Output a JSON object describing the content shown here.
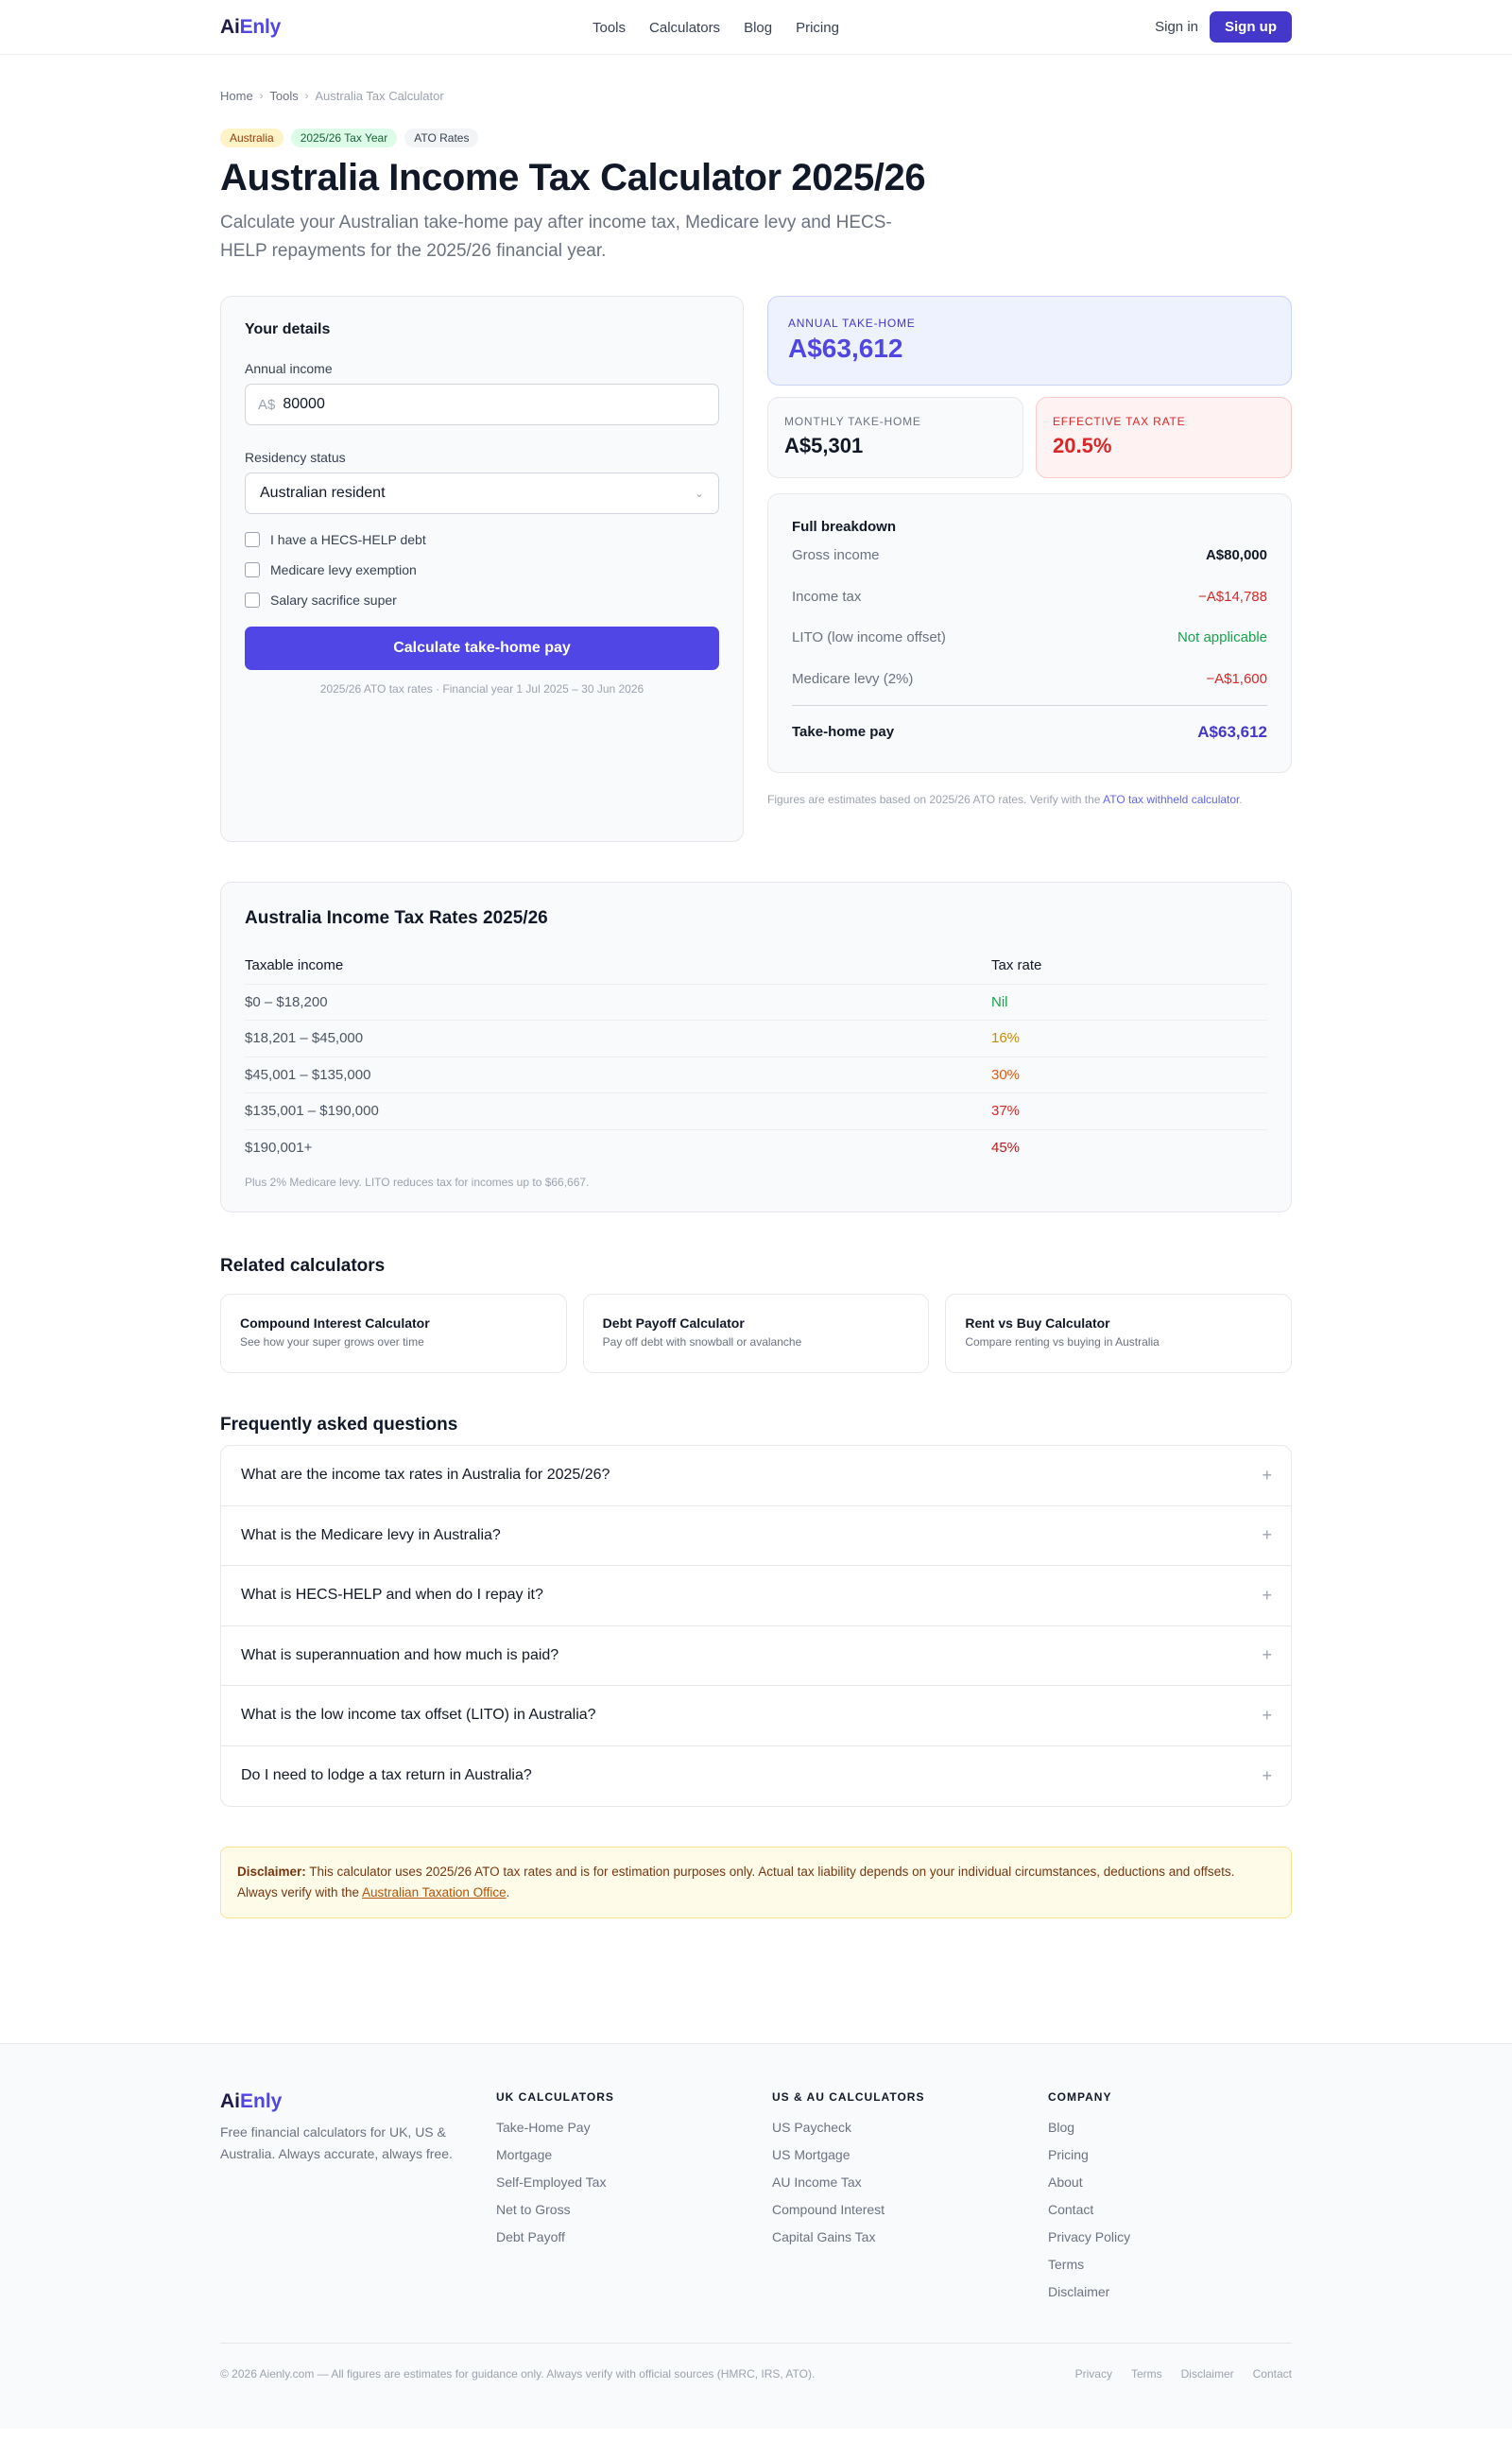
{
  "header": {
    "logo_a": "Ai",
    "logo_b": "Enly",
    "nav": [
      "Tools",
      "Calculators",
      "Blog",
      "Pricing"
    ],
    "signin": "Sign in",
    "signup": "Sign up"
  },
  "breadcrumb": [
    "Home",
    "Tools",
    "Australia Tax Calculator"
  ],
  "badges": [
    "Australia",
    "2025/26 Tax Year",
    "ATO Rates"
  ],
  "title": "Australia Income Tax Calculator 2025/26",
  "subtitle": "Calculate your Australian take-home pay after income tax, Medicare levy and HECS-HELP repayments for the 2025/26 financial year.",
  "form": {
    "title": "Your details",
    "income_label": "Annual income",
    "income_prefix": "A$",
    "income_value": "80000",
    "residency_label": "Residency status",
    "residency_value": "Australian resident",
    "checks": [
      "I have a HECS-HELP debt",
      "Medicare levy exemption",
      "Salary sacrifice super"
    ],
    "button": "Calculate take-home pay",
    "note": "2025/26 ATO tax rates · Financial year 1 Jul 2025 – 30 Jun 2026"
  },
  "results": {
    "annual_label": "ANNUAL TAKE-HOME",
    "annual_value": "A$63,612",
    "monthly_label": "MONTHLY TAKE-HOME",
    "monthly_value": "A$5,301",
    "rate_label": "EFFECTIVE TAX RATE",
    "rate_value": "20.5%",
    "breakdown_title": "Full breakdown",
    "breakdown": [
      {
        "label": "Gross income",
        "value": "A$80,000"
      },
      {
        "label": "Income tax",
        "value": "−A$14,788"
      },
      {
        "label": "LITO (low income offset)",
        "value": "Not applicable"
      },
      {
        "label": "Medicare levy (2%)",
        "value": "−A$1,600"
      }
    ],
    "total_label": "Take-home pay",
    "total_value": "A$63,612",
    "source_text": "Figures are estimates based on 2025/26 ATO rates. Verify with the ",
    "source_link": "ATO tax withheld calculator",
    "source_end": "."
  },
  "rates": {
    "title": "Australia Income Tax Rates 2025/26",
    "col_income": "Taxable income",
    "col_rate": "Tax rate",
    "rows": [
      {
        "income": "$0 – $18,200",
        "rate": "Nil"
      },
      {
        "income": "$18,201 – $45,000",
        "rate": "16%"
      },
      {
        "income": "$45,001 – $135,000",
        "rate": "30%"
      },
      {
        "income": "$135,001 – $190,000",
        "rate": "37%"
      },
      {
        "income": "$190,001+",
        "rate": "45%"
      }
    ],
    "note": "Plus 2% Medicare levy. LITO reduces tax for incomes up to $66,667."
  },
  "related": {
    "title": "Related calculators",
    "cards": [
      {
        "title": "Compound Interest Calculator",
        "desc": "See how your super grows over time"
      },
      {
        "title": "Debt Payoff Calculator",
        "desc": "Pay off debt with snowball or avalanche"
      },
      {
        "title": "Rent vs Buy Calculator",
        "desc": "Compare renting vs buying in Australia"
      }
    ]
  },
  "faq": {
    "title": "Frequently asked questions",
    "items": [
      "What are the income tax rates in Australia for 2025/26?",
      "What is the Medicare levy in Australia?",
      "What is HECS-HELP and when do I repay it?",
      "What is superannuation and how much is paid?",
      "What is the low income tax offset (LITO) in Australia?",
      "Do I need to lodge a tax return in Australia?"
    ]
  },
  "disclaimer": {
    "label": "Disclaimer:",
    "text": " This calculator uses 2025/26 ATO tax rates and is for estimation purposes only. Actual tax liability depends on your individual circumstances, deductions and offsets. Always verify with the ",
    "link": "Australian Taxation Office",
    "end": "."
  },
  "footer": {
    "logo_a": "Ai",
    "logo_b": "Enly",
    "tagline": "Free financial calculators for UK, US & Australia. Always accurate, always free.",
    "cols": [
      {
        "head": "UK CALCULATORS",
        "links": [
          "Take-Home Pay",
          "Mortgage",
          "Self-Employed Tax",
          "Net to Gross",
          "Debt Payoff"
        ]
      },
      {
        "head": "US & AU CALCULATORS",
        "links": [
          "US Paycheck",
          "US Mortgage",
          "AU Income Tax",
          "Compound Interest",
          "Capital Gains Tax"
        ]
      },
      {
        "head": "COMPANY",
        "links": [
          "Blog",
          "Pricing",
          "About",
          "Contact",
          "Privacy Policy",
          "Terms",
          "Disclaimer"
        ]
      }
    ],
    "copyright": "© 2026 Aienly.com — All figures are estimates for guidance only. Always verify with official sources (HMRC, IRS, ATO).",
    "legal": [
      "Privacy",
      "Terms",
      "Disclaimer",
      "Contact"
    ]
  },
  "colors": {
    "brand": "#4f46e5",
    "nil": "#16a34a",
    "r16": "#ca8a04",
    "r30": "#ea580c",
    "r37": "#dc2626",
    "r45": "#b91c1c"
  }
}
